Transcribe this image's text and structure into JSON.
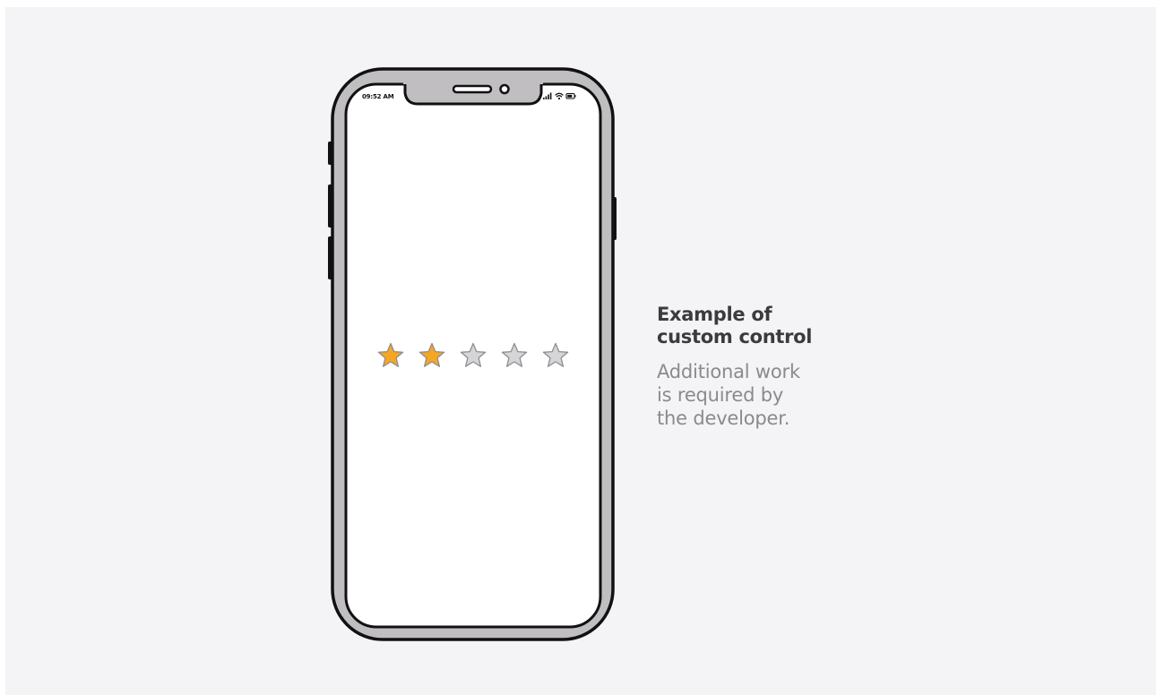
{
  "status_bar": {
    "time": "09:52 AM",
    "icons": [
      "signal-icon",
      "wifi-icon",
      "battery-icon"
    ]
  },
  "rating": {
    "value": 2,
    "max": 5,
    "filled_color": "#f5a623",
    "empty_color": "#d5d5d7"
  },
  "caption": {
    "title_line1": "Example of",
    "title_line2": "custom control",
    "body_line1": "Additional work",
    "body_line2": "is required by",
    "body_line3": "the developer."
  },
  "colors": {
    "background": "#f4f4f6",
    "phone_frame": "#c0bec0",
    "outline": "#111111",
    "title_text": "#3b3b3e",
    "body_text": "#8a8a8e"
  }
}
